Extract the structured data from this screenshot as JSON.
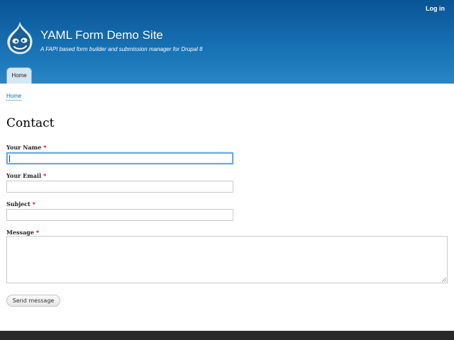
{
  "header": {
    "login_label": "Log in",
    "site_name": "YAML Form Demo Site",
    "slogan": "A FAPI based form builder and submission manager for Drupal 8",
    "logo_icon": "drupal-drop-icon"
  },
  "nav": {
    "tabs": [
      {
        "label": "Home",
        "active": true
      }
    ]
  },
  "breadcrumb": {
    "items": [
      {
        "label": "Home"
      }
    ]
  },
  "page": {
    "title": "Contact"
  },
  "form": {
    "required_marker": "*",
    "fields": [
      {
        "label": "Your Name",
        "value": "",
        "focused": true
      },
      {
        "label": "Your Email",
        "value": ""
      },
      {
        "label": "Subject",
        "value": ""
      },
      {
        "label": "Message",
        "value": ""
      }
    ],
    "submit_label": "Send message"
  },
  "colors": {
    "header_top": "#0a5493",
    "header_bottom": "#2a86c6",
    "link": "#0071b3",
    "required": "#e00000",
    "footer": "#292929"
  }
}
